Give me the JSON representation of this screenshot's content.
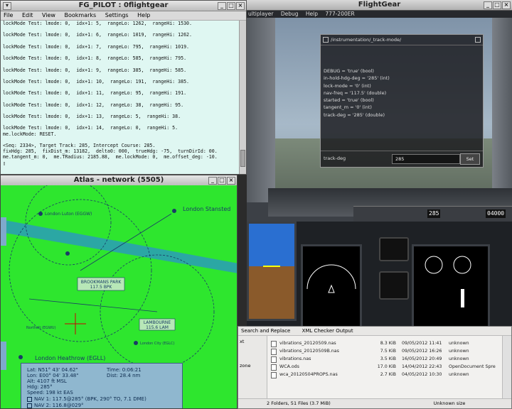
{
  "terminal": {
    "title": "FG_PILOT : 0flightgear",
    "menu": [
      "File",
      "Edit",
      "View",
      "Bookmarks",
      "Settings",
      "Help"
    ],
    "lines": [
      "lockMode Test: lmode: 0,  idx+1: 5,  rangeLo: 1262,  rangeHi: 1530.",
      "",
      "lockMode Test: lmode: 0,  idx+1: 6,  rangeLo: 1019,  rangeHi: 1262.",
      "",
      "lockMode Test: lmode: 0,  idx+1: 7,  rangeLo: 795,  rangeHi: 1019.",
      "",
      "lockMode Test: lmode: 0,  idx+1: 8,  rangeLo: 585,  rangeHi: 795.",
      "",
      "lockMode Test: lmode: 0,  idx+1: 9,  rangeLo: 385,  rangeHi: 585.",
      "",
      "lockMode Test: lmode: 0,  idx+1: 10,  rangeLo: 191,  rangeHi: 385.",
      "",
      "lockMode Test: lmode: 0,  idx+1: 11,  rangeLo: 95,  rangeHi: 191.",
      "",
      "lockMode Test: lmode: 0,  idx+1: 12,  rangeLo: 38,  rangeHi: 95.",
      "",
      "lockMode Test: lmode: 0,  idx+1: 13,  rangeLo: 5,  rangeHi: 38.",
      "",
      "lockMode Test: lmode: 0,  idx+1: 14,  rangeLo: 0,  rangeHi: 5.",
      "me.lockMode: RESET.",
      "",
      "<Seq: 2334>, Target Track: 285, Intercept Course: 285.",
      "fixHdg: 285,  fixDist_m: 13182,  delta0: 000,  trueHdg: -75,  turnDirId: 00.",
      "me.tangent_m: 0,  me.TRadius: 2185.88,  me.lockMode: 0,  me.offset_deg: -10.",
      "▯"
    ]
  },
  "flightgear": {
    "title": "FlightGear",
    "menu": [
      "ultiplayer",
      "Debug",
      "Help",
      "777-200ER"
    ],
    "dialog": {
      "title": "/instrumentation/_track-mode/",
      "props": [
        "DEBUG = 'true' (bool)",
        "in-hold-hdg-deg = '285' (int)",
        "lock-mode = '0' (int)",
        "nav-freq = '117.5' (double)",
        "started = 'true' (bool)",
        "tangent_m = '0' (int)",
        "track-deg = '285' (double)"
      ],
      "field_label": "track-deg",
      "field_value": "285",
      "set_label": "Set"
    },
    "mcp": {
      "hdg": "285",
      "alt": "04000"
    }
  },
  "atlas": {
    "title": "Atlas - network (5505)",
    "labels": {
      "luton": "London Luton (EGGW)",
      "stansted": "London Stansted",
      "brookmans": "BROOKMANS PARK",
      "brookmans_freq": "117.5 BPK",
      "lambourne": "LAMBOURNE",
      "lambourne_freq": "115.6 LAM",
      "heathrow": "London Heathrow (EGLL)",
      "city": "London City (EGLC)",
      "northolt": "Northolt (EGWU)"
    },
    "info": {
      "lat": "Lat: N51° 43' 04.62\"",
      "lon": "Lon: E00° 04' 33.48\"",
      "alt": "Alt: 4107 ft MSL",
      "hdg": "Hdg: 285°",
      "speed": "Speed: 198 kt EAS",
      "time": "Time: 0:06:21",
      "dist": "Dist: 28.4 nm",
      "nav1": "NAV 1: 117.5@285° (BPK, 290° TO, 7.1 DME)",
      "nav2": "NAV 2: 116.8@029°"
    }
  },
  "files": {
    "toolbar": [
      "Search and Replace",
      "XML Checker Output"
    ],
    "side_items": [
      "xt",
      "zone"
    ],
    "rows": [
      {
        "name": "vibrations_20120509.nas",
        "size": "8.3 KiB",
        "date": "09/05/2012 11:41",
        "type": "unknown"
      },
      {
        "name": "vibrations_20120509B.nas",
        "size": "7.5 KiB",
        "date": "09/05/2012 16:26",
        "type": "unknown"
      },
      {
        "name": "vibrations.nas",
        "size": "3.5 KiB",
        "date": "16/05/2012 20:49",
        "type": "unknown"
      },
      {
        "name": "WCA.ods",
        "size": "17.0 KiB",
        "date": "14/04/2012 22:43",
        "type": "OpenDocument Spre"
      },
      {
        "name": "wca_20120504PROPS.nas",
        "size": "2.7 KiB",
        "date": "04/05/2012 10:30",
        "type": "unknown"
      }
    ],
    "status": "2 Folders, 51 Files (3.7 MiB)",
    "status_right": "Unknown size"
  }
}
